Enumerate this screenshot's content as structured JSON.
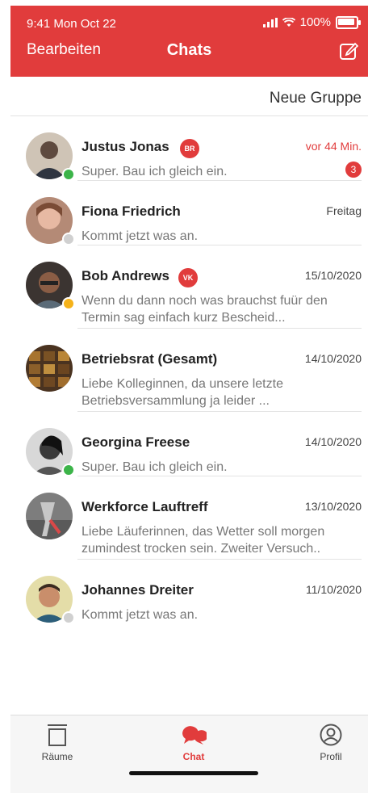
{
  "status": {
    "time": "9:41  Mon Oct 22",
    "battery": "100%"
  },
  "header": {
    "edit_label": "Bearbeiten",
    "title": "Chats"
  },
  "toolbar": {
    "new_group_label": "Neue Gruppe"
  },
  "chats": [
    {
      "name": "Justus Jonas",
      "role_badge": "BR",
      "date": "vor 44 Min.",
      "message": "Super. Bau ich gleich ein.",
      "unread": "3",
      "presence_color": "#3cb449",
      "avatar_color": "#5e4a3f"
    },
    {
      "name": "Fiona Friedrich",
      "date": "Freitag",
      "message": "Kommt jetzt was an.",
      "presence_color": "#d0d0d0",
      "avatar_color": "#c9957b"
    },
    {
      "name": "Bob Andrews",
      "role_badge": "VK",
      "date": "15/10/2020",
      "message": "Wenn du dann noch was brauchst fuür den Termin sag einfach kurz Bescheid...",
      "presence_color": "#f5b21a",
      "avatar_color": "#4b3a33"
    },
    {
      "name": "Betriebsrat (Gesamt)",
      "date": "14/10/2020",
      "message": "Liebe Kolleginnen, da unsere letzte Betriebsversammlung ja leider ...",
      "avatar_color": "#6a4a2a"
    },
    {
      "name": "Georgina Freese",
      "date": "14/10/2020",
      "message": "Super. Bau ich gleich ein.",
      "presence_color": "#3cb449",
      "avatar_color": "#7a7a7a"
    },
    {
      "name": "Werkforce Lauftreff",
      "date": "13/10/2020",
      "message": "Liebe Läuferinnen, das Wetter soll morgen zumindest trocken sein. Zweiter Versuch..",
      "avatar_color": "#8a8a8a"
    },
    {
      "name": "Johannes Dreiter",
      "date": "11/10/2020",
      "message": "Kommt jetzt was an.",
      "presence_color": "#d0d0d0",
      "avatar_color": "#d9c98a"
    }
  ],
  "tabs": [
    {
      "label": "Räume",
      "icon": "rooms-icon"
    },
    {
      "label": "Chat",
      "icon": "chat-icon"
    },
    {
      "label": "Profil",
      "icon": "profile-icon"
    }
  ],
  "colors": {
    "accent": "#e13c3c"
  }
}
